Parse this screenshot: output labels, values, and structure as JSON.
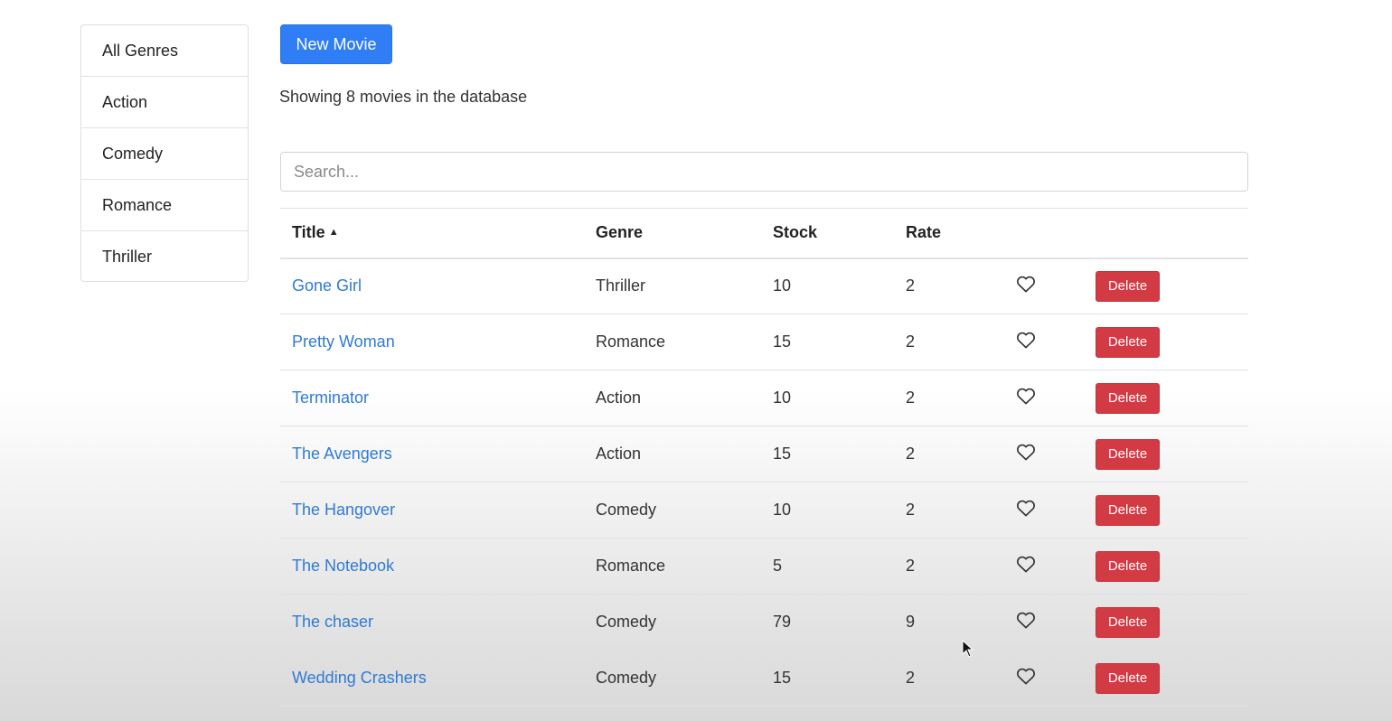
{
  "sidebar": {
    "genres": [
      {
        "label": "All Genres"
      },
      {
        "label": "Action"
      },
      {
        "label": "Comedy"
      },
      {
        "label": "Romance"
      },
      {
        "label": "Thriller"
      }
    ]
  },
  "toolbar": {
    "new_movie_label": "New Movie"
  },
  "summary": {
    "text": "Showing 8 movies in the database"
  },
  "search": {
    "placeholder": "Search...",
    "value": ""
  },
  "table": {
    "headers": {
      "title": "Title",
      "genre": "Genre",
      "stock": "Stock",
      "rate": "Rate"
    },
    "sort_icon": "caret-up",
    "delete_label": "Delete",
    "rows": [
      {
        "title": "Gone Girl",
        "genre": "Thriller",
        "stock": "10",
        "rate": "2"
      },
      {
        "title": "Pretty Woman",
        "genre": "Romance",
        "stock": "15",
        "rate": "2"
      },
      {
        "title": "Terminator",
        "genre": "Action",
        "stock": "10",
        "rate": "2"
      },
      {
        "title": "The Avengers",
        "genre": "Action",
        "stock": "15",
        "rate": "2"
      },
      {
        "title": "The Hangover",
        "genre": "Comedy",
        "stock": "10",
        "rate": "2"
      },
      {
        "title": "The Notebook",
        "genre": "Romance",
        "stock": "5",
        "rate": "2"
      },
      {
        "title": "The chaser",
        "genre": "Comedy",
        "stock": "79",
        "rate": "9"
      },
      {
        "title": "Wedding Crashers",
        "genre": "Comedy",
        "stock": "15",
        "rate": "2"
      }
    ]
  },
  "colors": {
    "primary": "#2f7ef6",
    "danger": "#d33b44",
    "link": "#2f7ad6"
  }
}
